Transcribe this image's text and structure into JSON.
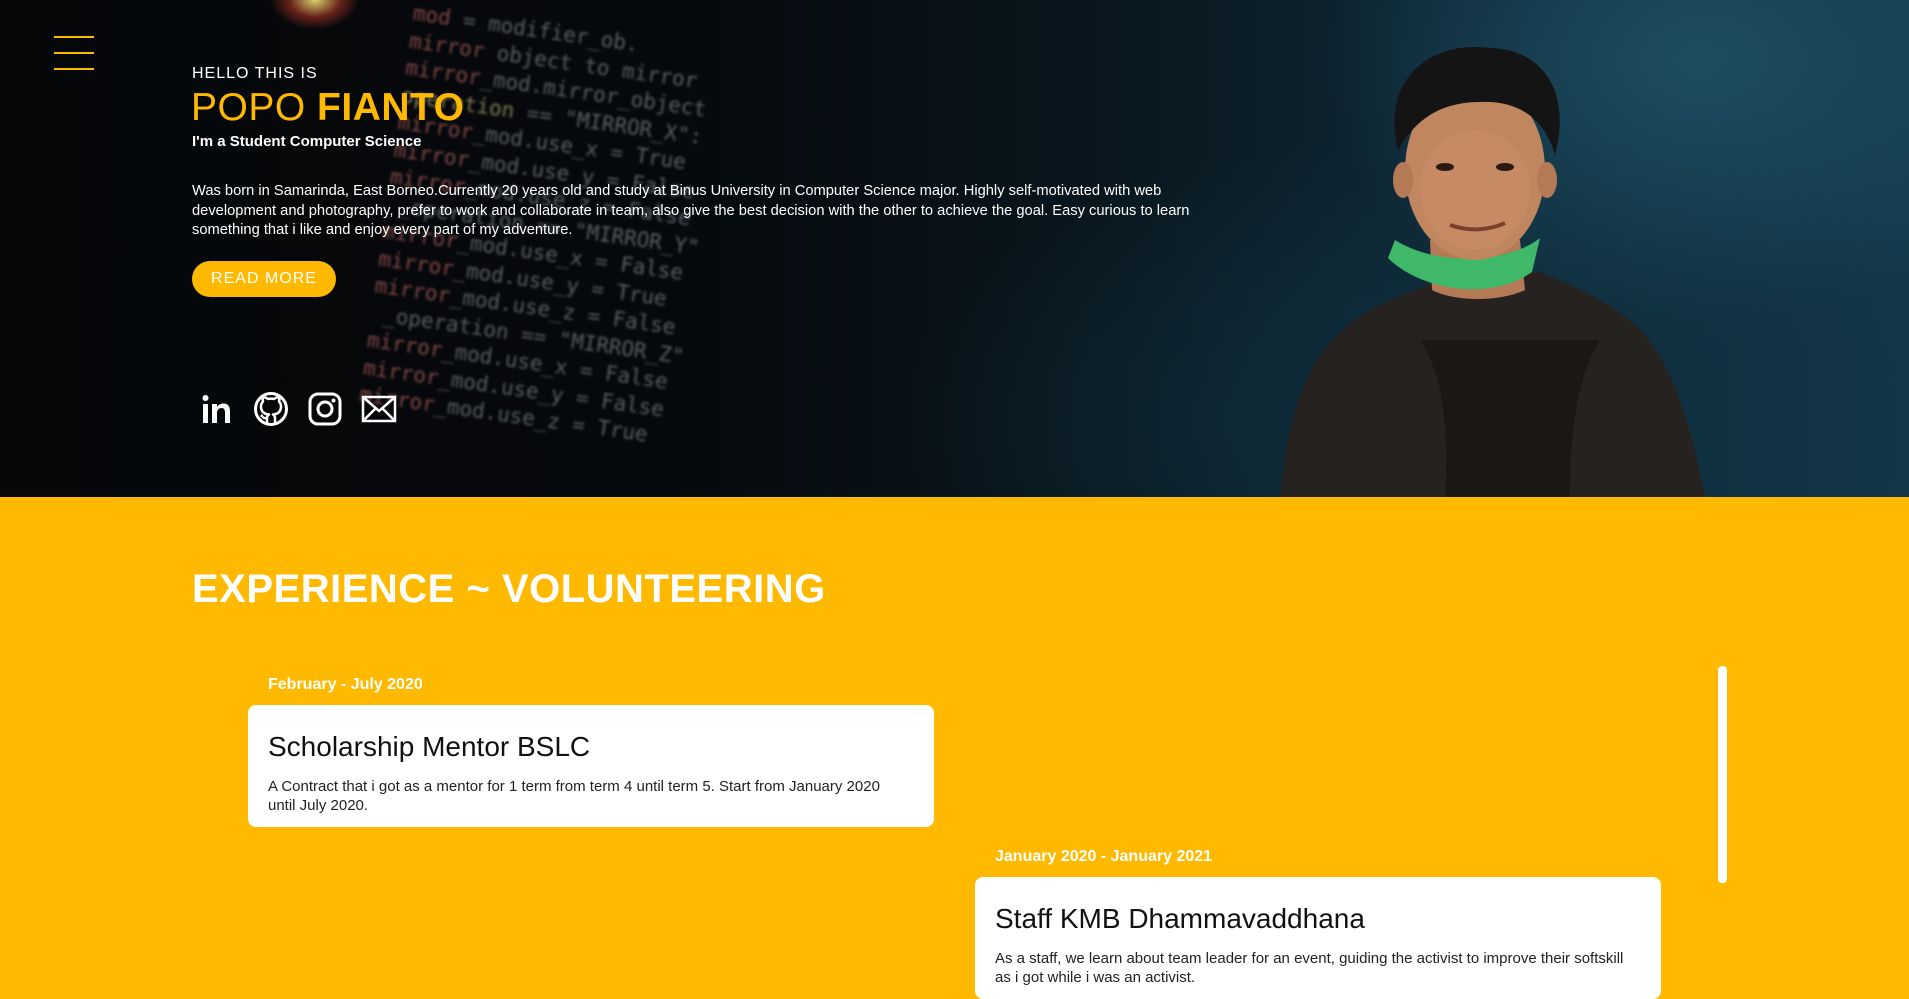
{
  "hero": {
    "hello": "HELLO THIS IS",
    "first_name": "POPO",
    "last_name": "FIANTO",
    "subtitle": "I'm a Student Computer Science",
    "bio": "Was born in Samarinda, East Borneo.Currently 20 years old and study at Binus University in Computer Science major. Highly self-motivated with web development and photography, prefer to work and collaborate in team, also give the best decision with the other to achieve the goal. Easy curious to learn something that i like and enjoy every part of my adventure.",
    "read_more": "READ MORE",
    "socials": [
      "linkedin-icon",
      "github-icon",
      "instagram-icon",
      "mail-icon"
    ]
  },
  "experience": {
    "title": "EXPERIENCE ~ VOLUNTEERING",
    "items": [
      {
        "date": "February - July 2020",
        "title": "Scholarship Mentor BSLC",
        "desc": "A Contract that i got as a mentor for 1 term from term 4 until term 5. Start from January 2020 until July 2020."
      },
      {
        "date": "January 2020 - January 2021",
        "title": "Staff KMB Dhammavaddhana",
        "desc": "As a staff, we learn about team leader for an event, guiding the activist to improve their softskill as i got while i was an activist."
      }
    ]
  },
  "colors": {
    "accent": "#ffb900",
    "hero_bg": "#06090c",
    "text_light": "#ffffff"
  }
}
